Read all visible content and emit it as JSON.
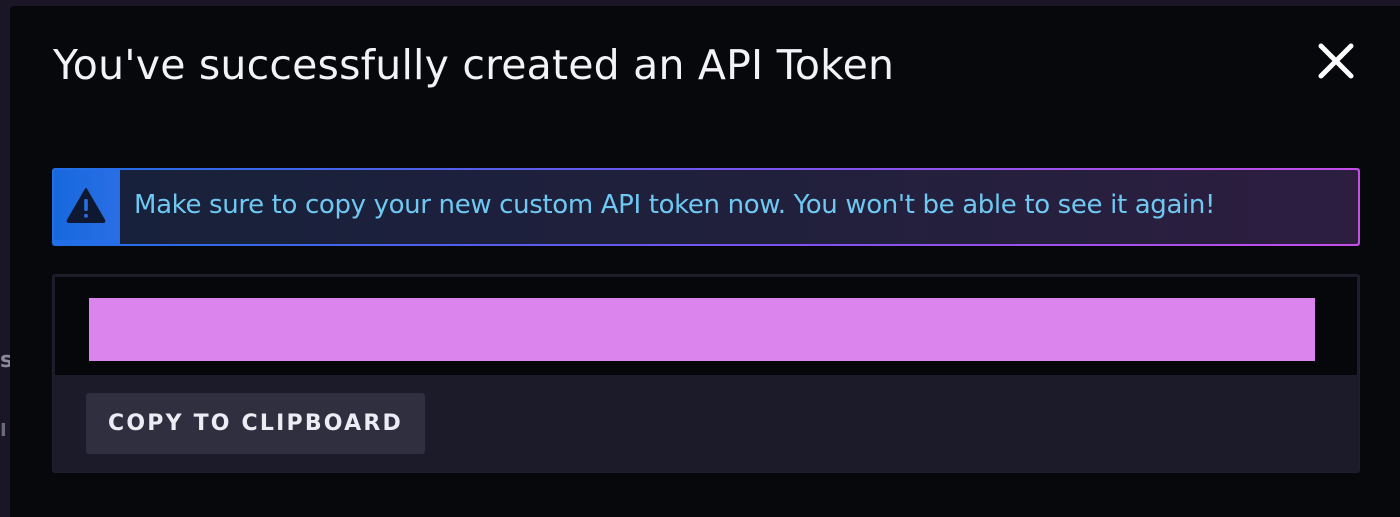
{
  "background": {
    "fragments": [
      "s",
      "I"
    ]
  },
  "modal": {
    "title": "You've successfully created an API Token",
    "close_icon": "close-icon"
  },
  "alert": {
    "icon": "warning-triangle-icon",
    "message": "Make sure to copy your new custom API token now. You won't be able to see it again!",
    "colors": {
      "gradient_start": "#1f6fe6",
      "gradient_end": "#c54ee8",
      "text": "#6fc8f2"
    }
  },
  "token": {
    "redaction_color": "#db84ee"
  },
  "actions": {
    "copy_label": "COPY TO CLIPBOARD"
  }
}
